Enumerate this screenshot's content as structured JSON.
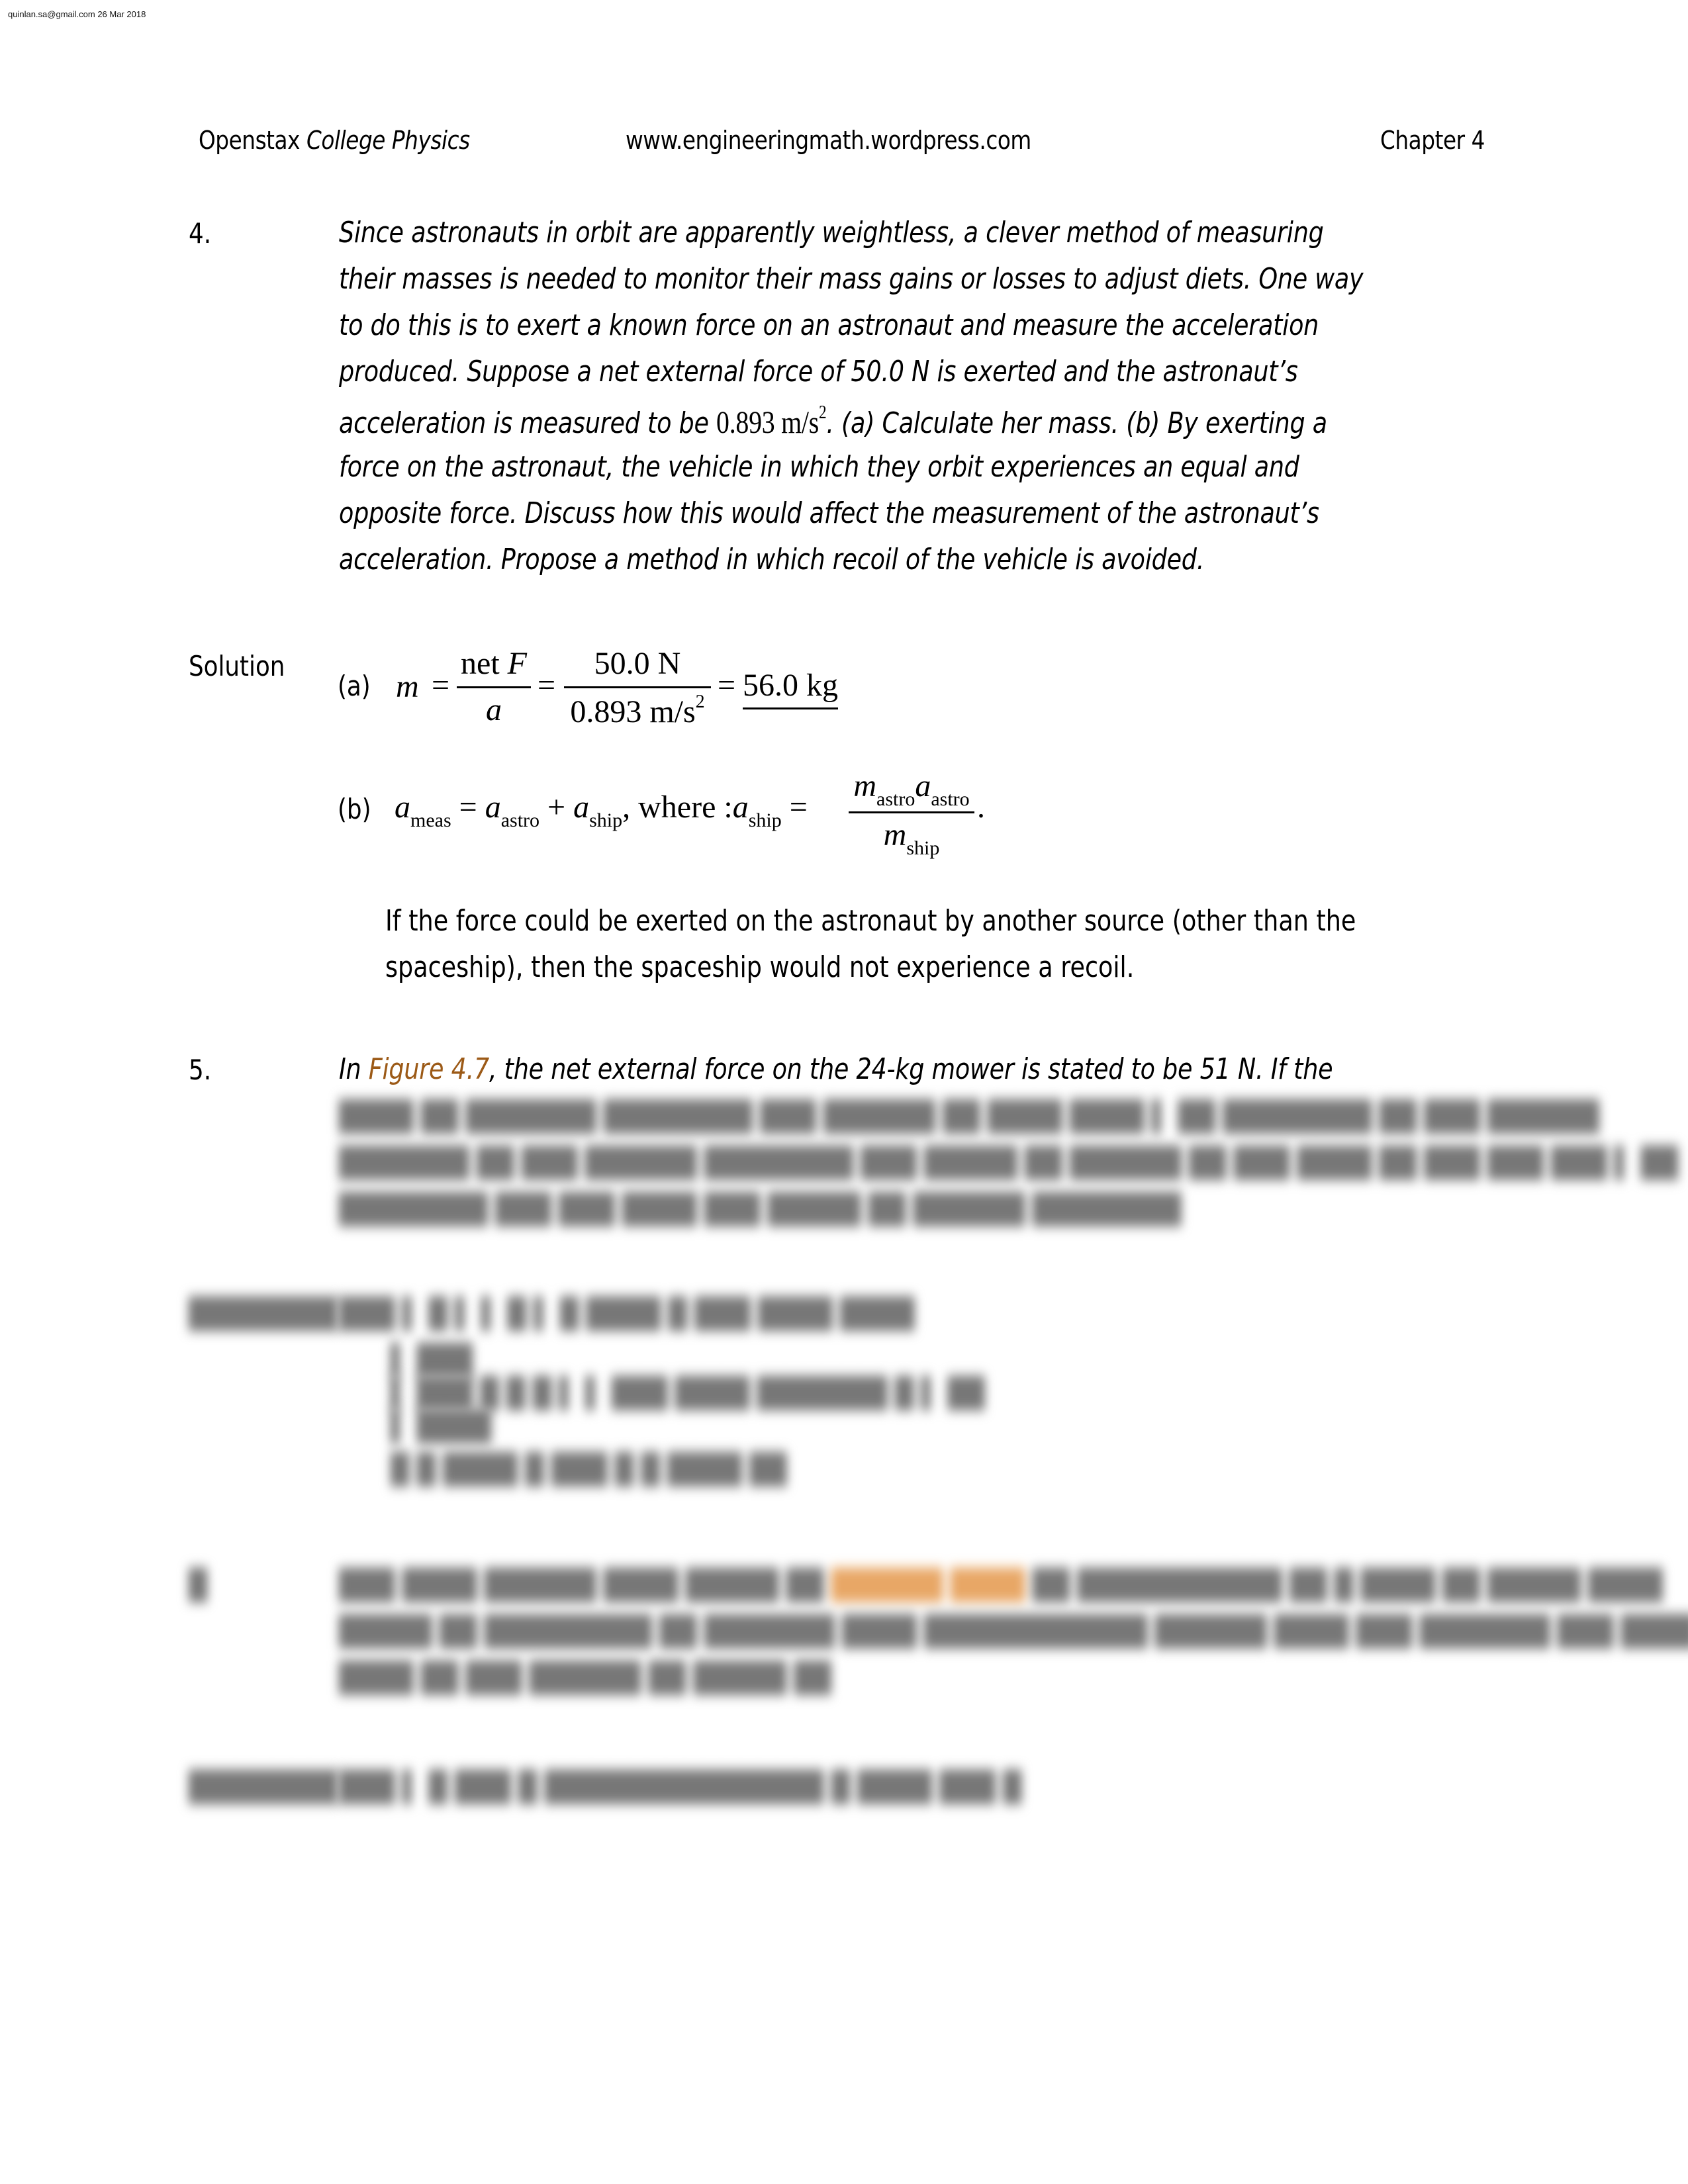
{
  "watermark": "quinlan.sa@gmail.com 26 Mar 2018",
  "header": {
    "book_prefix": "Openstax ",
    "book_title": "College Physics",
    "website": "www.engineeringmath.wordpress.com",
    "chapter": "Chapter 4"
  },
  "problem4": {
    "number": "4.",
    "lines": [
      "Since astronauts in orbit are apparently weightless, a clever method of measuring",
      "their masses is needed to monitor their mass gains or losses to adjust diets. One way",
      "to do this is to exert a known force on an astronaut and measure the acceleration",
      "produced. Suppose a net external force of 50.0 N is exerted and the astronaut’s"
    ],
    "line5_before": "acceleration is measured to be ",
    "line5_value": "0.893 m/s",
    "line5_exp": "2",
    "line5_after": ". (a) Calculate her mass. (b) By exerting a",
    "lines_after": [
      "force on the astronaut, the vehicle in which they orbit experiences an equal and",
      "opposite force. Discuss how this would affect the measurement of the astronaut’s",
      "acceleration. Propose a method in which recoil of the vehicle is avoided."
    ],
    "solution_label": "Solution",
    "part_a": {
      "label": "(a)",
      "lhs": "m",
      "eq": "=",
      "frac1_num": "net F",
      "frac1_num_word": "net ",
      "frac1_num_var": "F",
      "frac1_den": "a",
      "frac2_num": "50.0 N",
      "frac2_den": "0.893 m/s",
      "frac2_den_exp": "2",
      "result": "56.0 kg"
    },
    "part_b": {
      "label": "(b)",
      "a": "a",
      "sub_meas": "meas",
      "sub_astro": "astro",
      "sub_ship": "ship",
      "m": "m",
      "plus": "+",
      "eq": "=",
      "where": ", where :",
      "period": "."
    },
    "explanation_lines": [
      "If the force could be exerted on the astronaut by another source (other than the",
      "spaceship), then the spaceship would not experience a recoil."
    ]
  },
  "problem5": {
    "number": "5.",
    "line1_before": "In ",
    "line1_link": "Figure 4.7",
    "line1_after": ", the net external force on the 24-kg mower is stated to be 51 N. If the"
  },
  "blurred_placeholder": "content hidden (blurred preview)"
}
